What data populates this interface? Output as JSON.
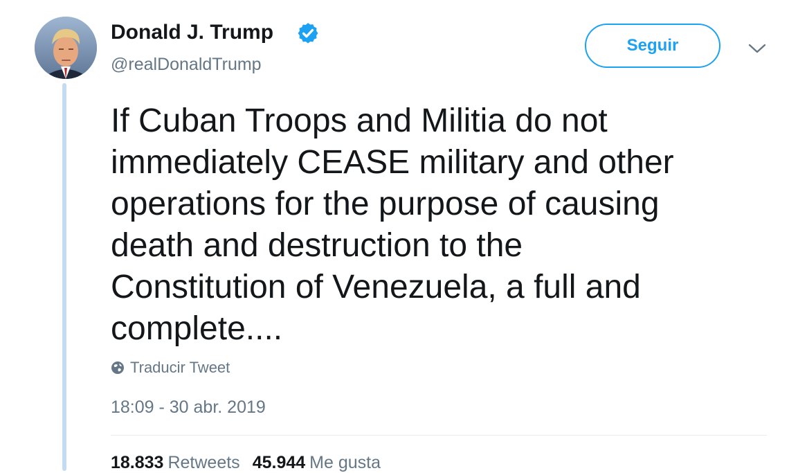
{
  "colors": {
    "accent": "#1da1f2",
    "text_primary": "#14171a",
    "text_secondary": "#657786",
    "thread_line": "#c4dcf1",
    "divider": "#e6ecf0"
  },
  "author": {
    "display_name": "Donald J. Trump",
    "handle": "@realDonaldTrump",
    "verified_icon": "verified-badge-icon",
    "avatar_icon": "profile-photo"
  },
  "header": {
    "follow_label": "Seguir",
    "menu_icon": "chevron-down-icon"
  },
  "tweet": {
    "text": "If Cuban Troops and Militia do not\nimmediately CEASE military and other\noperations for the purpose of causing\ndeath and destruction to the\nConstitution of Venezuela, a full and\ncomplete....",
    "translate_label": "Traducir Tweet",
    "translate_icon": "globe-icon",
    "timestamp": "18:09 - 30 abr. 2019"
  },
  "stats": {
    "retweets_count": "18.833",
    "retweets_label": "Retweets",
    "likes_count": "45.944",
    "likes_label": "Me gusta"
  }
}
